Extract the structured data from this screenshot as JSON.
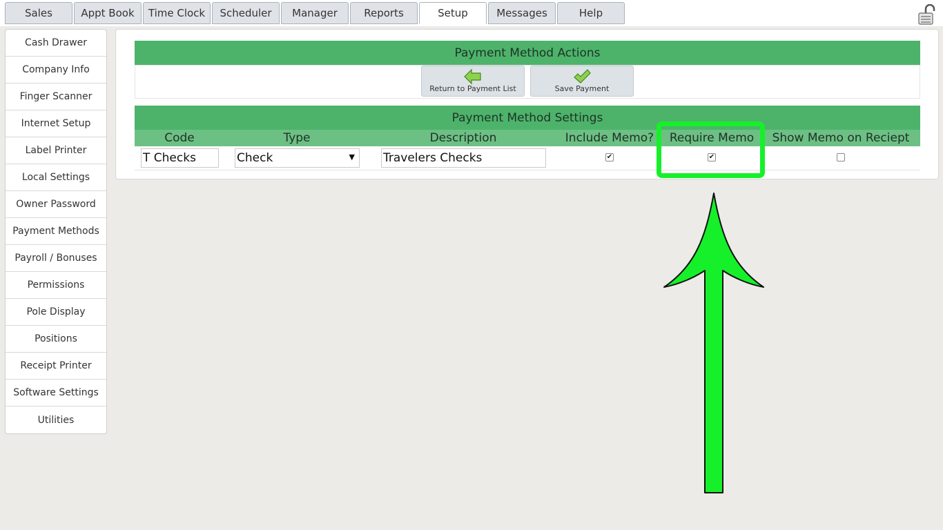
{
  "nav": {
    "tabs": [
      "Sales",
      "Appt Book",
      "Time Clock",
      "Scheduler",
      "Manager",
      "Reports",
      "Setup",
      "Messages",
      "Help"
    ],
    "active_tab": "Setup"
  },
  "sidebar": {
    "items": [
      "Cash Drawer",
      "Company Info",
      "Finger Scanner",
      "Internet Setup",
      "Label Printer",
      "Local Settings",
      "Owner Password",
      "Payment Methods",
      "Payroll / Bonuses",
      "Permissions",
      "Pole Display",
      "Positions",
      "Receipt Printer",
      "Software Settings",
      "Utilities"
    ]
  },
  "actions": {
    "title": "Payment Method Actions",
    "return_label": "Return to Payment List",
    "save_label": "Save Payment"
  },
  "settings": {
    "title": "Payment Method Settings",
    "columns": [
      "Code",
      "Type",
      "Description",
      "Include Memo?",
      "Require Memo",
      "Show Memo on Reciept"
    ],
    "row": {
      "code": "T Checks",
      "type": "Check",
      "description": "Travelers Checks",
      "include_memo": true,
      "require_memo": true,
      "show_memo_on_receipt": false
    }
  },
  "colors": {
    "section_header": "#4db36b",
    "column_header": "#6dc083",
    "annotation": "#16f02a"
  }
}
